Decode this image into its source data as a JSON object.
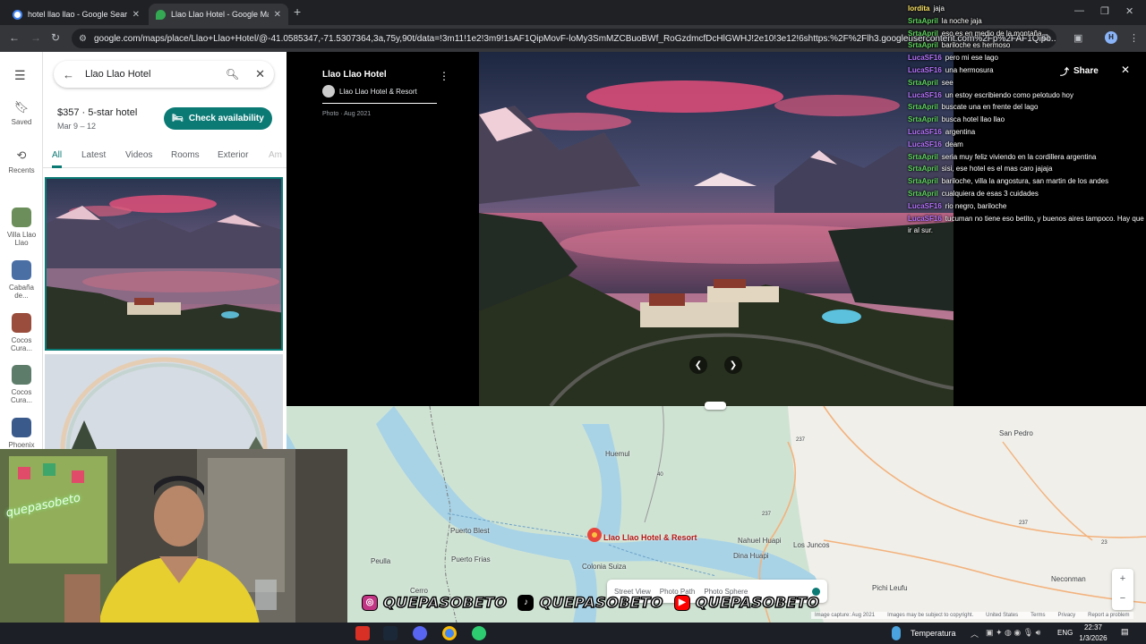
{
  "browser": {
    "tabs": [
      {
        "title": "hotel llao llao - Google Search",
        "close": "✕"
      },
      {
        "title": "Llao Llao Hotel - Google Maps",
        "close": "✕"
      }
    ],
    "new_tab": "+",
    "url": "google.com/maps/place/Llao+Llao+Hotel/@-41.0585347,-71.5307364,3a,75y,90t/data=!3m11!1e2!3m9!1sAF1QipMovF-loMy3SmMZCBuoBWf_RoGzdmcfDcHlGWHJ!2e10!3e12!6shttps:%2F%2Flh3.googleusercontent.com%2Fp%2FAF1Qipo...",
    "profile_initial": "H"
  },
  "rail": {
    "saved": "Saved",
    "recents": "Recents",
    "places": [
      {
        "label": "Villa Llao Llao",
        "color": "#6b8e5a"
      },
      {
        "label": "Cabaña de...",
        "color": "#4a6fa5"
      },
      {
        "label": "Cocos Cura...",
        "color": "#9a4d3c"
      },
      {
        "label": "Cocos Cura...",
        "color": "#5d7d6a"
      },
      {
        "label": "Phoenix",
        "color": "#3a5a8c"
      }
    ]
  },
  "panel": {
    "search_value": "Llao Llao Hotel",
    "price": "$357 · 5-star hotel",
    "dates": "Mar 9 – 12",
    "availability_button": "Check availability",
    "tabs": [
      "All",
      "Latest",
      "Videos",
      "Rooms",
      "Exterior",
      "Am"
    ]
  },
  "viewer": {
    "title": "Llao Llao Hotel",
    "author": "Llao Llao Hotel & Resort",
    "date": "Photo · Aug 2021",
    "share": "Share"
  },
  "chat": [
    {
      "user": "lordita",
      "color": "yellow",
      "text": "jaja"
    },
    {
      "user": "SrtaApril",
      "color": "green",
      "text": "la noche jaja"
    },
    {
      "user": "SrtaApril",
      "color": "green",
      "text": "eso es en medio de la montaña"
    },
    {
      "user": "SrtaApril",
      "color": "green",
      "text": "bariloche es hermoso"
    },
    {
      "user": "LucaSF16",
      "color": "purple",
      "text": "pero mi ese lago"
    },
    {
      "user": "LucaSF16",
      "color": "purple",
      "text": "una hermosura"
    },
    {
      "user": "SrtaApril",
      "color": "green",
      "text": "see"
    },
    {
      "user": "LucaSF16",
      "color": "purple",
      "text": "un estoy escribiendo como pelotudo hoy"
    },
    {
      "user": "SrtaApril",
      "color": "green",
      "text": "buscate una en frente del lago"
    },
    {
      "user": "SrtaApril",
      "color": "green",
      "text": "busca hotel llao llao"
    },
    {
      "user": "LucaSF16",
      "color": "purple",
      "text": "argentina"
    },
    {
      "user": "LucaSF16",
      "color": "purple",
      "text": "deam"
    },
    {
      "user": "SrtaApril",
      "color": "green",
      "text": "seria muy feliz viviendo en la cordillera argentina"
    },
    {
      "user": "SrtaApril",
      "color": "green",
      "text": "sisi, ese hotel es el mas caro jajaja"
    },
    {
      "user": "SrtaApril",
      "color": "green",
      "text": "bariloche, villa la angostura, san martin de los andes"
    },
    {
      "user": "SrtaApril",
      "color": "green",
      "text": "cualquiera de esas 3 cuidades"
    },
    {
      "user": "LucaSF16",
      "color": "purple",
      "text": "rio negro, bariloche"
    },
    {
      "user": "LucaSF16",
      "color": "purple",
      "text": "tucuman no tiene eso betito, y buenos aires tampoco. Hay que ir al sur."
    }
  ],
  "map": {
    "hotel_label": "Llao Llao Hotel & Resort",
    "places": [
      "Huemul",
      "Puerto Blest",
      "Puerto Frias",
      "Peulla",
      "Colonia Suiza",
      "Nahuel Huapi",
      "Dina Huapi",
      "Los Juncos",
      "San Pedro",
      "Pichi Leufu",
      "Neconman",
      "Cerro"
    ],
    "routes": [
      "237",
      "40",
      "237",
      "237",
      "23"
    ],
    "layers": [
      "Street View",
      "Photo Path",
      "Photo Sphere"
    ],
    "footer": [
      "Image capture: Aug 2021",
      "Images may be subject to copyright.",
      "United States",
      "Terms",
      "Privacy",
      "Report a problem"
    ]
  },
  "stream": {
    "handle": "QUEPASOBETO",
    "sign": "quepasobeto"
  },
  "taskbar": {
    "weather": "Temperatura",
    "lang": "ENG",
    "time": "22:37",
    "date": "1/3/2026"
  }
}
